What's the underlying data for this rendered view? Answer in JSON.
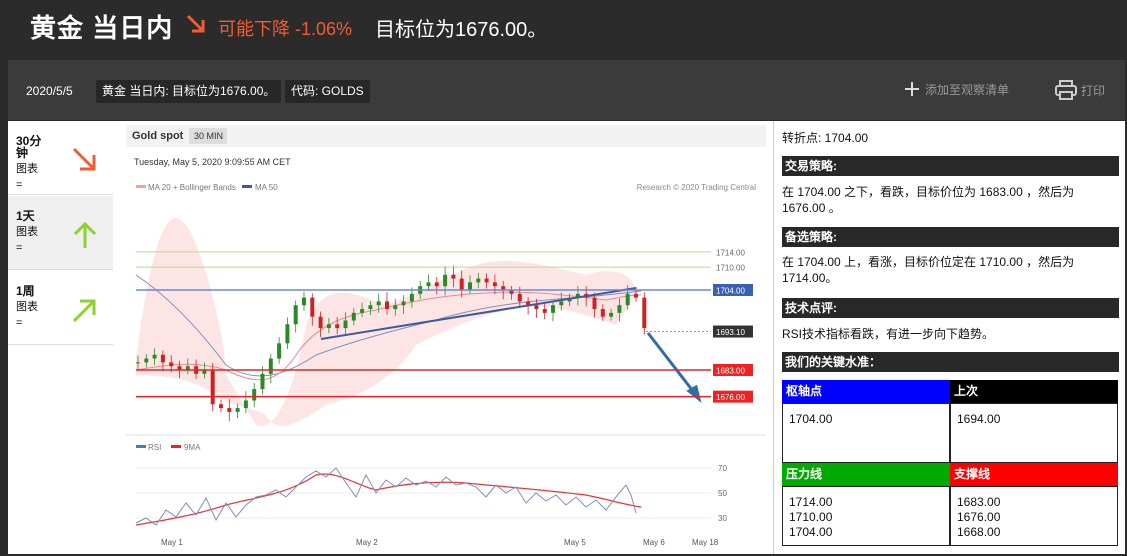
{
  "header": {
    "title": "黄金 当日内",
    "trend_label": "可能下降 -1.06%",
    "target_label": "目标位为1676.00。"
  },
  "toolbar": {
    "date": "2020/5/5",
    "description": "黄金 当日内: 目标位为1676.00。",
    "code": "代码: GOLDS",
    "watch_label": "添加至观察清单",
    "print_label": "打印"
  },
  "timeframes": [
    {
      "label": "30分钟",
      "sub": "图表",
      "sub2": "=",
      "direction": "down",
      "color": "#f25c30"
    },
    {
      "label": "1天",
      "sub": "图表",
      "sub2": "=",
      "direction": "up",
      "color": "#8bd22f"
    },
    {
      "label": "1周",
      "sub": "图表",
      "sub2": "=",
      "direction": "up-right",
      "color": "#8bd22f"
    }
  ],
  "chart": {
    "instrument": "Gold spot",
    "interval": "30 MIN",
    "timestamp": "Tuesday, May 5, 2020 9:09:55 AM CET",
    "legend_bb": "MA 20 + Bollinger Bands",
    "legend_ma50": "MA 50",
    "credit": "Research © 2020 Trading Central",
    "legend_rsi": "RSI",
    "legend_9ma": "9MA",
    "levels": [
      {
        "value": "1714.00",
        "kind": "resistance"
      },
      {
        "value": "1710.00",
        "kind": "resistance"
      },
      {
        "value": "1704.00",
        "kind": "pivot"
      },
      {
        "value": "1693.10",
        "kind": "last"
      },
      {
        "value": "1683.00",
        "kind": "support"
      },
      {
        "value": "1676.00",
        "kind": "support"
      }
    ],
    "rsi_ticks": [
      "70",
      "50",
      "30"
    ],
    "x_ticks": [
      "May 1",
      "May 2",
      "May 5",
      "May 6",
      "May 18"
    ]
  },
  "chart_data": {
    "type": "candlestick",
    "title": "Gold spot",
    "interval": "30 MIN",
    "horizontal_levels": [
      1714.0,
      1710.0,
      1704.0,
      1693.1,
      1683.0,
      1676.0
    ],
    "x_ticks": [
      "May 1",
      "May 2",
      "May 5",
      "May 6",
      "May 18"
    ],
    "rsi_ylim": [
      30,
      70
    ],
    "series": [
      {
        "name": "MA 20 + Bollinger Bands"
      },
      {
        "name": "MA 50"
      },
      {
        "name": "RSI"
      },
      {
        "name": "9MA"
      }
    ]
  },
  "analysis": {
    "pivot_line": "转折点: 1704.00",
    "strategy_head": "交易策略:",
    "strategy_text": "在 1704.00 之下，看跌，目标价位为 1683.00 ，然后为 1676.00 。",
    "alt_head": "备选策略:",
    "alt_text": "在 1704.00 上，看涨，目标价位定在 1710.00 ，然后为 1714.00。",
    "comment_head": "技术点评:",
    "comment_text": "RSI技术指标看跌，有进一步向下趋势。",
    "levels_head": "我们的关键水准：",
    "pivot_head": "枢轴点",
    "last_head": "上次",
    "pivot_value": "1704.00",
    "last_value": "1694.00",
    "res_head": "压力线",
    "sup_head": "支撑线",
    "resistances": [
      "1714.00",
      "1710.00",
      "1704.00"
    ],
    "supports": [
      "1683.00",
      "1676.00",
      "1668.00"
    ]
  },
  "colors": {
    "trend_down": "#f25c30",
    "trend_up": "#8bd22f",
    "pivot_blue": "#0000ff",
    "resistance_green": "#00aa00",
    "support_red": "#ff0000"
  }
}
